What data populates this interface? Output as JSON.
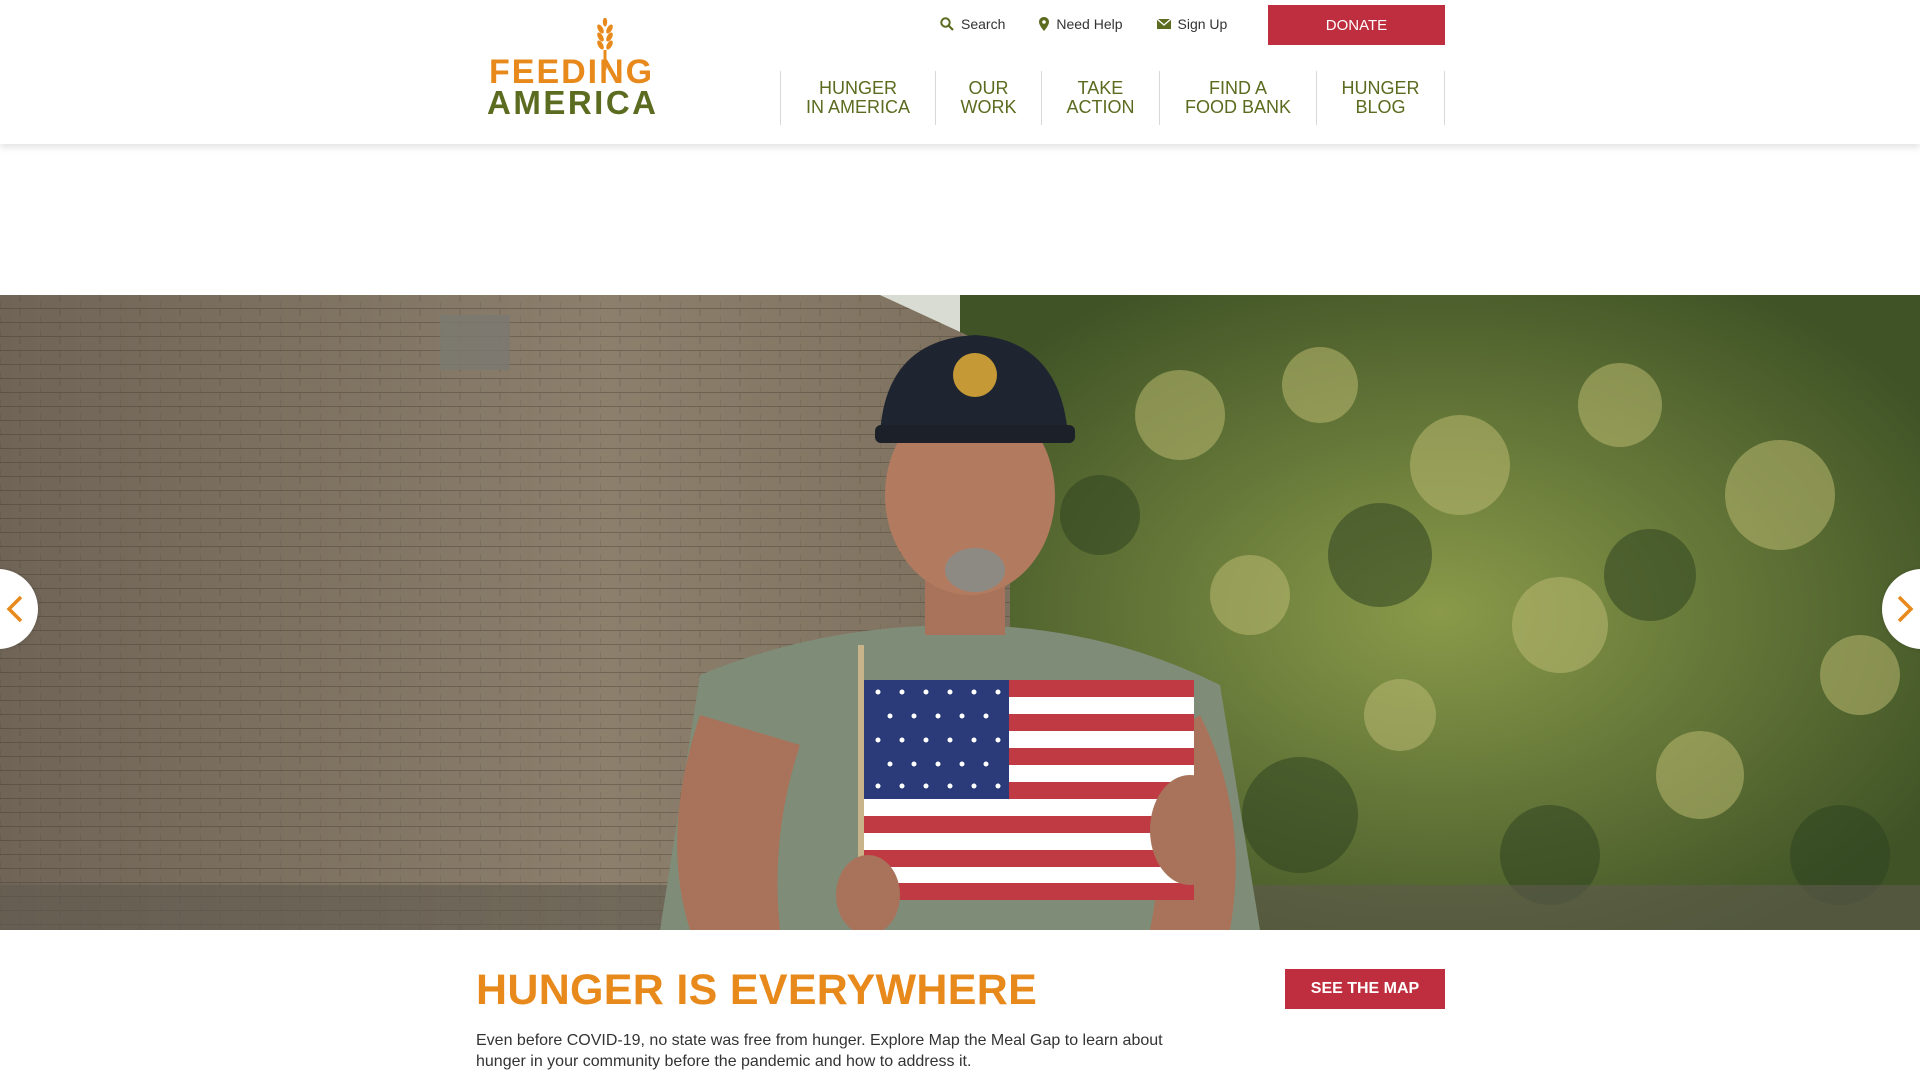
{
  "logo": {
    "line1": "FEEDING",
    "line2": "AMERICA",
    "icon": "wheat-icon",
    "orange": "#e8891b",
    "green": "#5b6b1f"
  },
  "utility_nav": [
    {
      "label": "Search",
      "icon": "search-icon"
    },
    {
      "label": "Need Help",
      "icon": "location-pin-icon"
    },
    {
      "label": "Sign Up",
      "icon": "envelope-icon"
    }
  ],
  "donate_label": "DONATE",
  "main_nav": [
    {
      "line1": "HUNGER",
      "line2": "IN AMERICA"
    },
    {
      "line1": "OUR",
      "line2": "WORK"
    },
    {
      "line1": "TAKE",
      "line2": "ACTION"
    },
    {
      "line1": "FIND A",
      "line2": "FOOD BANK"
    },
    {
      "line1": "HUNGER",
      "line2": "BLOG"
    }
  ],
  "hero": {
    "prev_icon": "chevron-left-icon",
    "next_icon": "chevron-right-icon"
  },
  "callout": {
    "title": "HUNGER IS EVERYWHERE",
    "text": "Even before COVID-19, no state was free from hunger. Explore Map the Meal Gap to learn about hunger in your community before the pandemic and how to address it.",
    "button": "SEE THE MAP"
  },
  "colors": {
    "accent_red": "#bf2e3e",
    "accent_orange": "#e8891b",
    "nav_green": "#5b6b1f"
  }
}
